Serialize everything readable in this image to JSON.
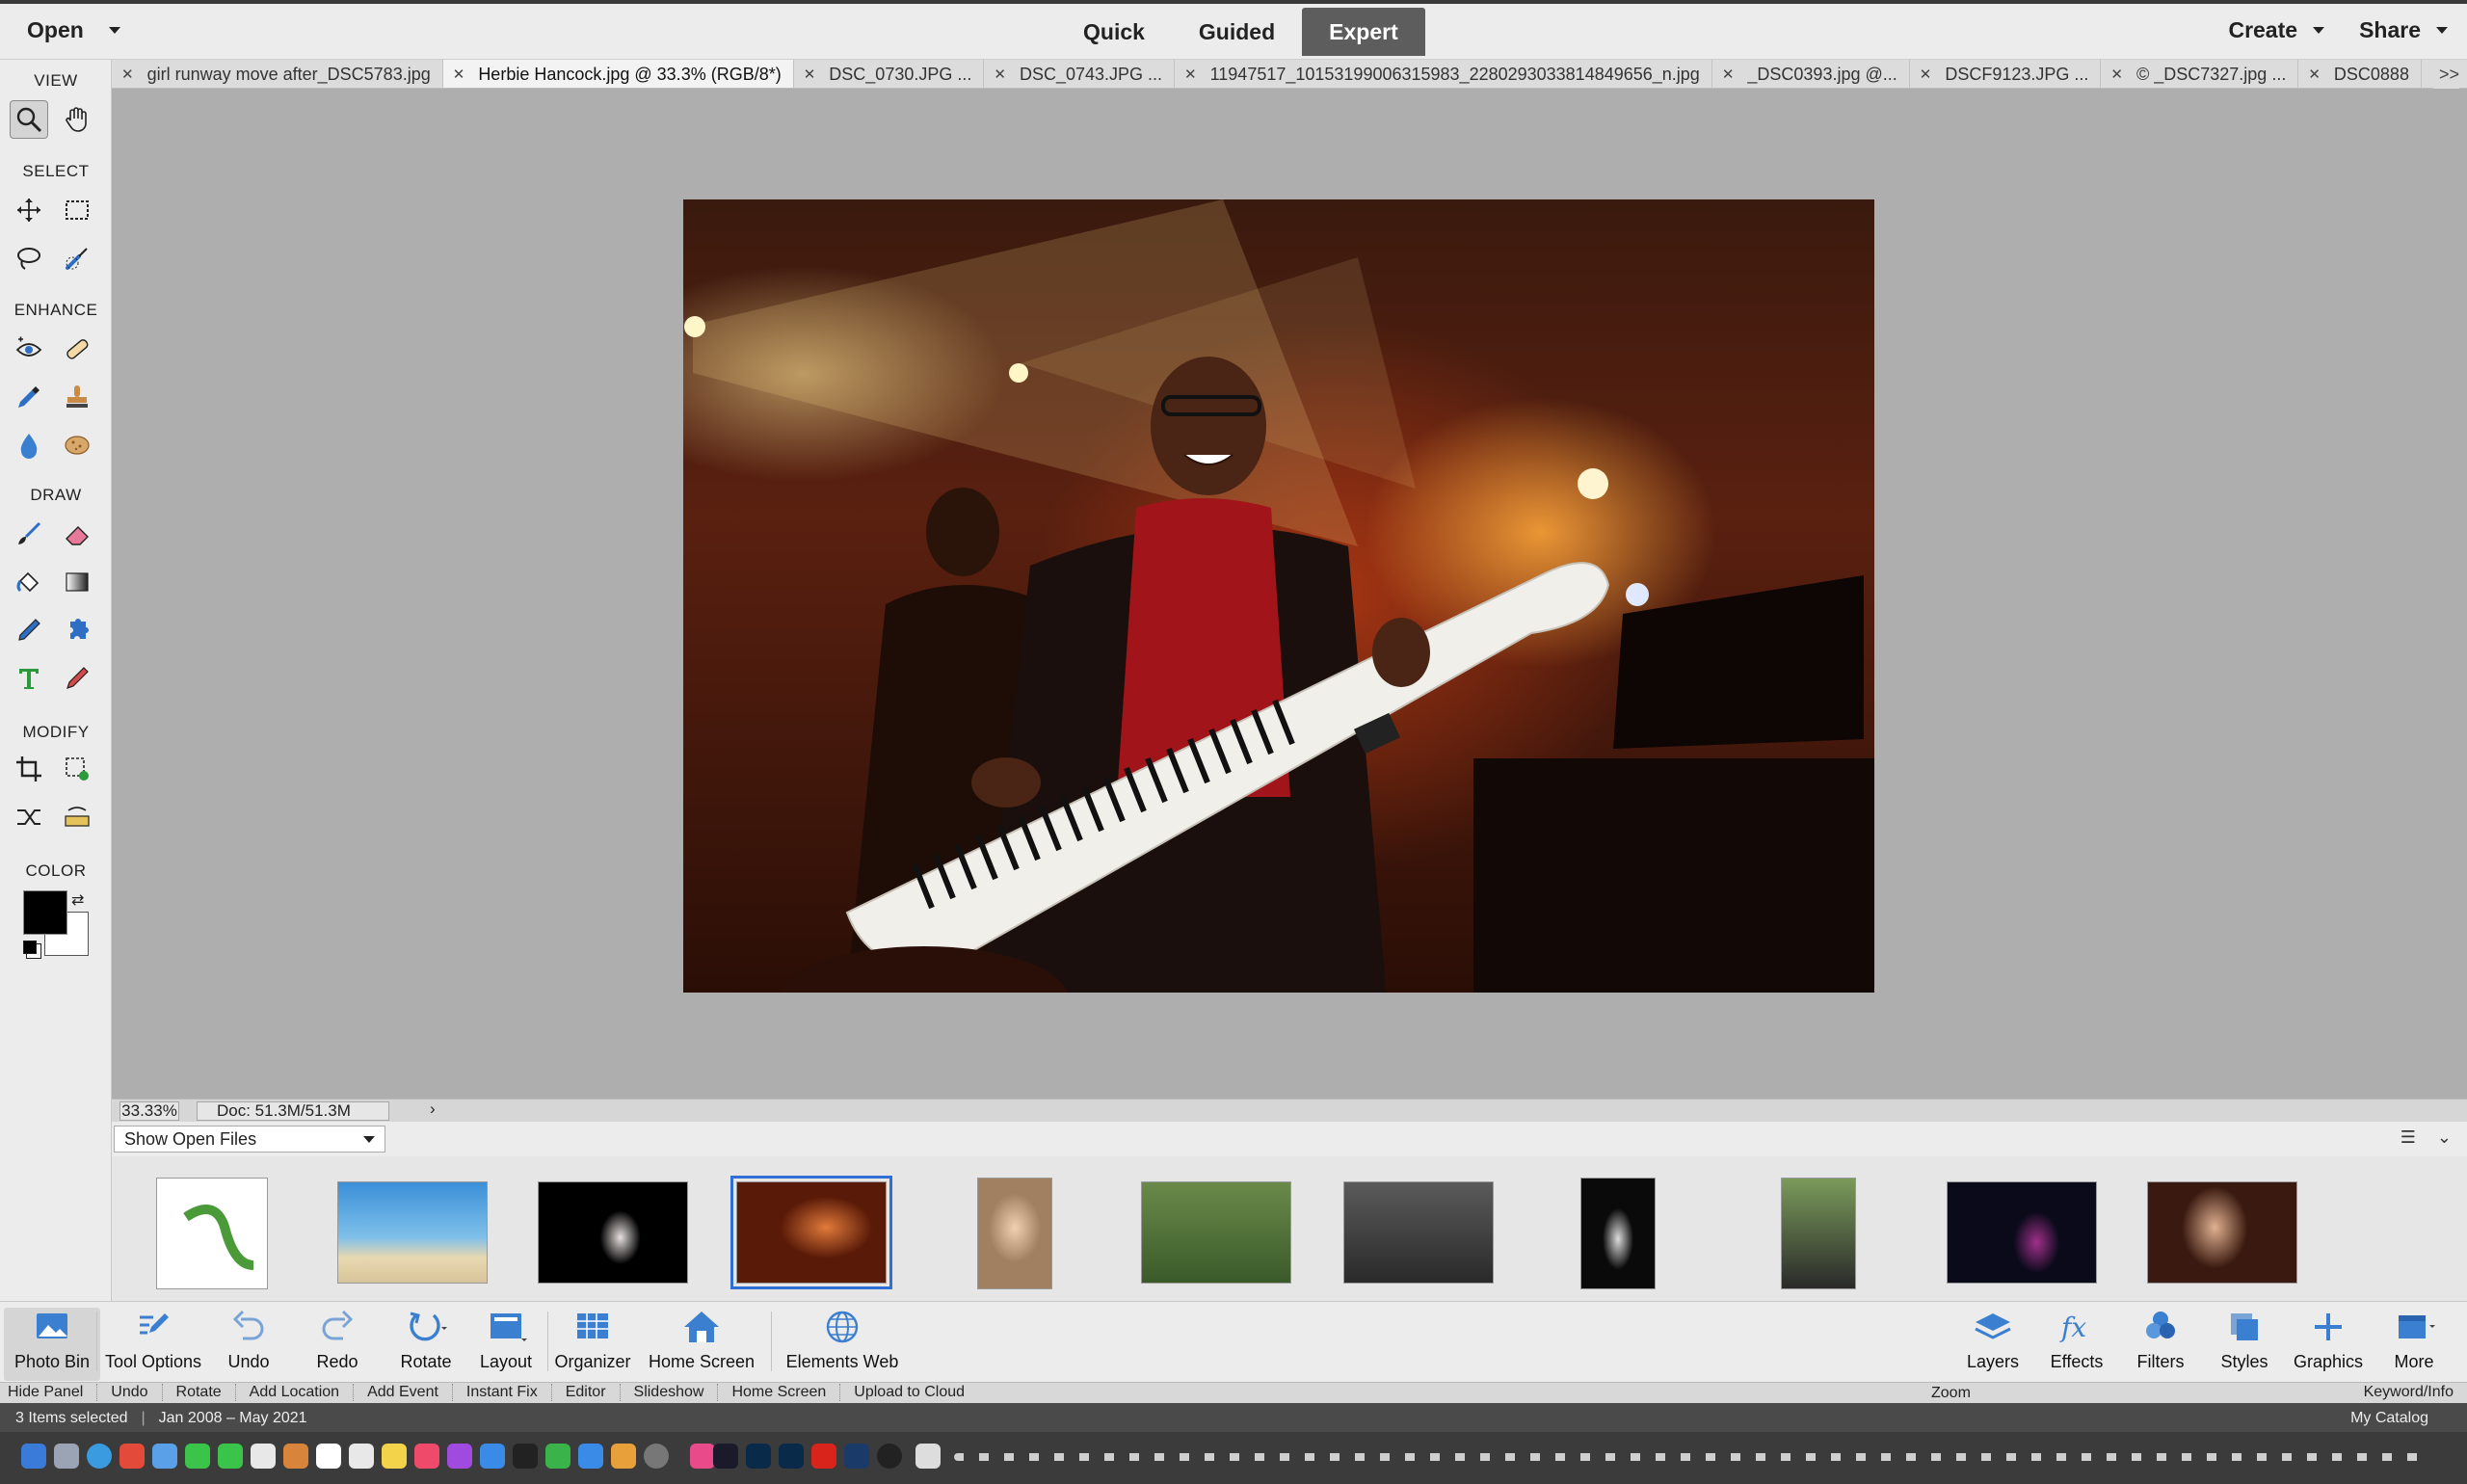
{
  "topbar": {
    "open_label": "Open",
    "modes": [
      "Quick",
      "Guided",
      "Expert"
    ],
    "active_mode": "Expert",
    "create_label": "Create",
    "share_label": "Share"
  },
  "toolbox": {
    "sections": [
      "VIEW",
      "SELECT",
      "ENHANCE",
      "DRAW",
      "MODIFY",
      "COLOR"
    ]
  },
  "tabs": [
    {
      "label": "girl runway move after_DSC5783.jpg",
      "active": false
    },
    {
      "label": "Herbie Hancock.jpg @ 33.3% (RGB/8*)",
      "active": true
    },
    {
      "label": "DSC_0730.JPG ...",
      "active": false
    },
    {
      "label": "DSC_0743.JPG ...",
      "active": false
    },
    {
      "label": "11947517_10153199006315983_2280293033814849656_n.jpg",
      "active": false
    },
    {
      "label": "_DSC0393.jpg @...",
      "active": false
    },
    {
      "label": "DSCF9123.JPG ...",
      "active": false
    },
    {
      "label": "© _DSC7327.jpg ...",
      "active": false
    },
    {
      "label": "DSC0888",
      "active": false
    }
  ],
  "tabs_overflow": ">>",
  "status": {
    "zoom": "33.33%",
    "doc": "Doc: 51.3M/51.3M",
    "arrow": "›"
  },
  "bin": {
    "dropdown": "Show Open Files"
  },
  "actions": {
    "photo_bin": "Photo Bin",
    "tool_options": "Tool Options",
    "undo": "Undo",
    "redo": "Redo",
    "rotate": "Rotate",
    "layout": "Layout",
    "organizer": "Organizer",
    "home_screen": "Home Screen",
    "elements_web": "Elements Web",
    "layers": "Layers",
    "effects": "Effects",
    "filters": "Filters",
    "styles": "Styles",
    "graphics": "Graphics",
    "more": "More"
  },
  "menustrip": {
    "items": [
      "Hide Panel",
      "Undo",
      "Rotate",
      "Add Location",
      "Add Event",
      "Instant Fix",
      "Editor",
      "Slideshow",
      "Home Screen",
      "Upload to Cloud"
    ],
    "zoom": "Zoom",
    "keyword": "Keyword/Info"
  },
  "orgstatus": {
    "selected": "3 Items selected",
    "range": "Jan 2008 – May 2021",
    "catalog": "My Catalog"
  },
  "colors": {
    "accent_blue": "#2f6fd6",
    "active_mode_bg": "#5d5d5d"
  }
}
